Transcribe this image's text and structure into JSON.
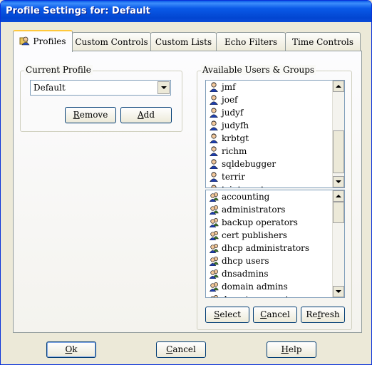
{
  "window": {
    "title": "Profile Settings for: Default"
  },
  "tabs": [
    {
      "label": "Profiles",
      "active": true,
      "icon": "profile-icon"
    },
    {
      "label": "Custom Controls"
    },
    {
      "label": "Custom Lists"
    },
    {
      "label": "Echo Filters"
    },
    {
      "label": "Time Controls"
    }
  ],
  "current_profile": {
    "group_label": "Current Profile",
    "selected": "Default",
    "remove_label": "Remove",
    "remove_hotkey": "R",
    "remove_rest": "emove",
    "add_label": "Add",
    "add_hotkey": "A",
    "add_rest": "dd"
  },
  "available": {
    "group_label": "Available Users & Groups",
    "users": [
      "jmf",
      "joef",
      "judyf",
      "judyfh",
      "krbtgt",
      "richm",
      "sqldebugger",
      "terrir",
      "tsinternetuser"
    ],
    "groups": [
      "accounting",
      "administrators",
      "backup operators",
      "cert publishers",
      "dhcp administrators",
      "dhcp users",
      "dnsadmins",
      "domain admins",
      "domain computers"
    ],
    "select_label": "Select",
    "select_hotkey": "S",
    "select_rest": "elect",
    "cancel_label": "Cancel",
    "cancel_hotkey": "C",
    "cancel_rest": "ancel",
    "refresh_label": "Refresh",
    "refresh_hotkey": "f",
    "refresh_pre": "Re",
    "refresh_rest": "resh"
  },
  "footer": {
    "ok_hotkey": "O",
    "ok_rest": "k",
    "cancel_hotkey": "C",
    "cancel_rest": "ancel",
    "help_hotkey": "H",
    "help_rest": "elp"
  },
  "icons": {
    "user": "user-icon",
    "group": "group-icon"
  }
}
